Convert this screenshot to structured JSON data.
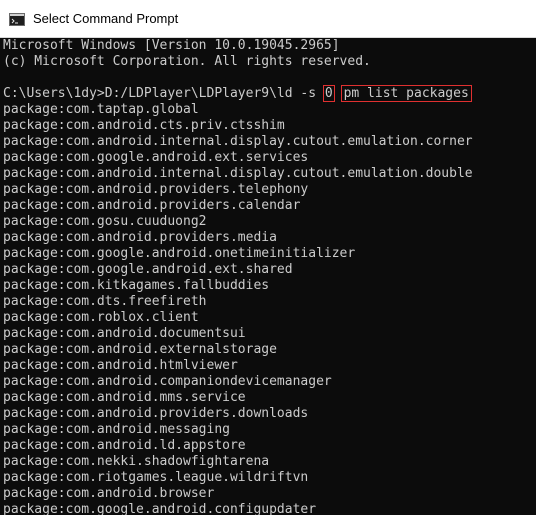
{
  "window": {
    "title": "Select Command Prompt",
    "icon": "console-icon"
  },
  "console": {
    "header_lines": [
      "Microsoft Windows [Version 10.0.19045.2965]",
      "(c) Microsoft Corporation. All rights reserved."
    ],
    "prompt": "C:\\Users\\1dy>D:/LDPlayer\\LDPlayer9\\ld -s ",
    "device_index": "0",
    "command": "pm list packages",
    "output_lines": [
      "package:com.taptap.global",
      "package:com.android.cts.priv.ctsshim",
      "package:com.android.internal.display.cutout.emulation.corner",
      "package:com.google.android.ext.services",
      "package:com.android.internal.display.cutout.emulation.double",
      "package:com.android.providers.telephony",
      "package:com.android.providers.calendar",
      "package:com.gosu.cuuduong2",
      "package:com.android.providers.media",
      "package:com.google.android.onetimeinitializer",
      "package:com.google.android.ext.shared",
      "package:com.kitkagames.fallbuddies",
      "package:com.dts.freefireth",
      "package:com.roblox.client",
      "package:com.android.documentsui",
      "package:com.android.externalstorage",
      "package:com.android.htmlviewer",
      "package:com.android.companiondevicemanager",
      "package:com.android.mms.service",
      "package:com.android.providers.downloads",
      "package:com.android.messaging",
      "package:com.android.ld.appstore",
      "package:com.nekki.shadowfightarena",
      "package:com.riotgames.league.wildriftvn",
      "package:com.android.browser",
      "package:com.google.android.configupdater"
    ]
  },
  "colors": {
    "console_bg": "#0c0c0c",
    "console_text": "#cccccc",
    "highlight_box": "#e03030",
    "titlebar_bg": "#ffffff"
  }
}
